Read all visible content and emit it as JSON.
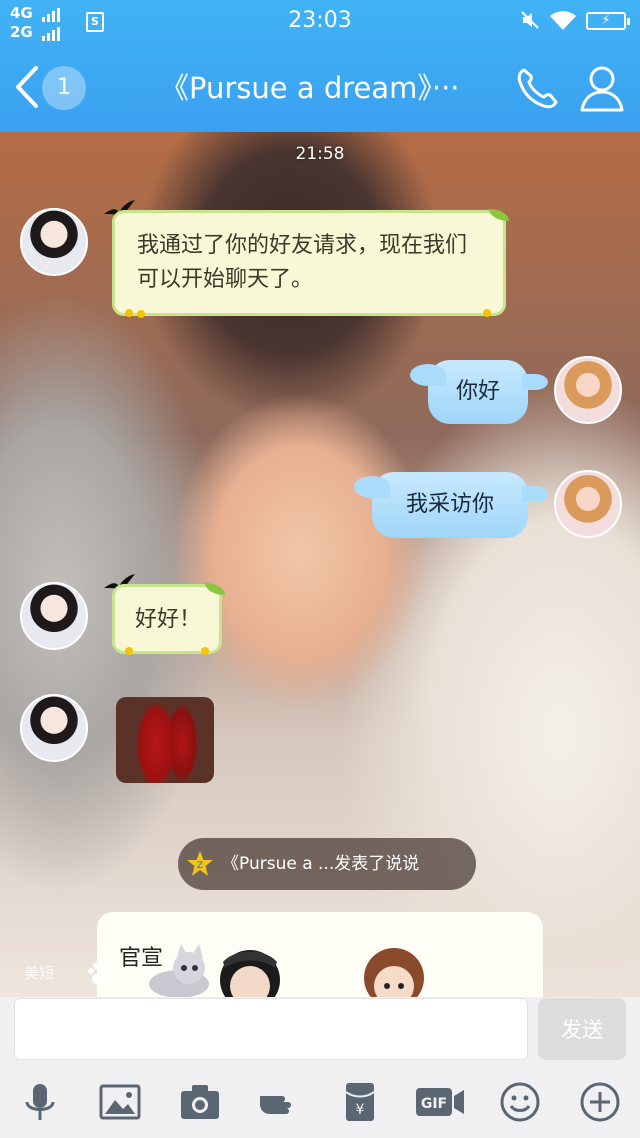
{
  "status_bar": {
    "network_top": "4G",
    "network_bottom": "2G",
    "sim_label": "S",
    "time": "23:03"
  },
  "header": {
    "unread_count": "1",
    "title": "《Pursue a dream》···"
  },
  "chat": {
    "timestamp": "21:58",
    "messages": [
      {
        "side": "in",
        "text": "我通过了你的好友请求，现在我们可以开始聊天了。"
      },
      {
        "side": "out",
        "text": "你好"
      },
      {
        "side": "out",
        "text": "我采访你"
      },
      {
        "side": "in",
        "text": "好好！"
      }
    ],
    "feed_notice": "《Pursue a ...发表了说说",
    "card_text": "官宣",
    "card_badge": "美短"
  },
  "composer": {
    "placeholder": "",
    "send_label": "发送"
  },
  "toolbar": {
    "items": [
      "microphone-icon",
      "image-icon",
      "camera-icon",
      "hand-icon",
      "red-packet-icon",
      "gif-icon",
      "emoji-icon",
      "plus-icon"
    ],
    "gif_label": "GIF"
  },
  "colors": {
    "header": "#3aa7f3",
    "incoming_bubble": "#f8f8d7",
    "outgoing_bubble": "#aedcfb"
  }
}
